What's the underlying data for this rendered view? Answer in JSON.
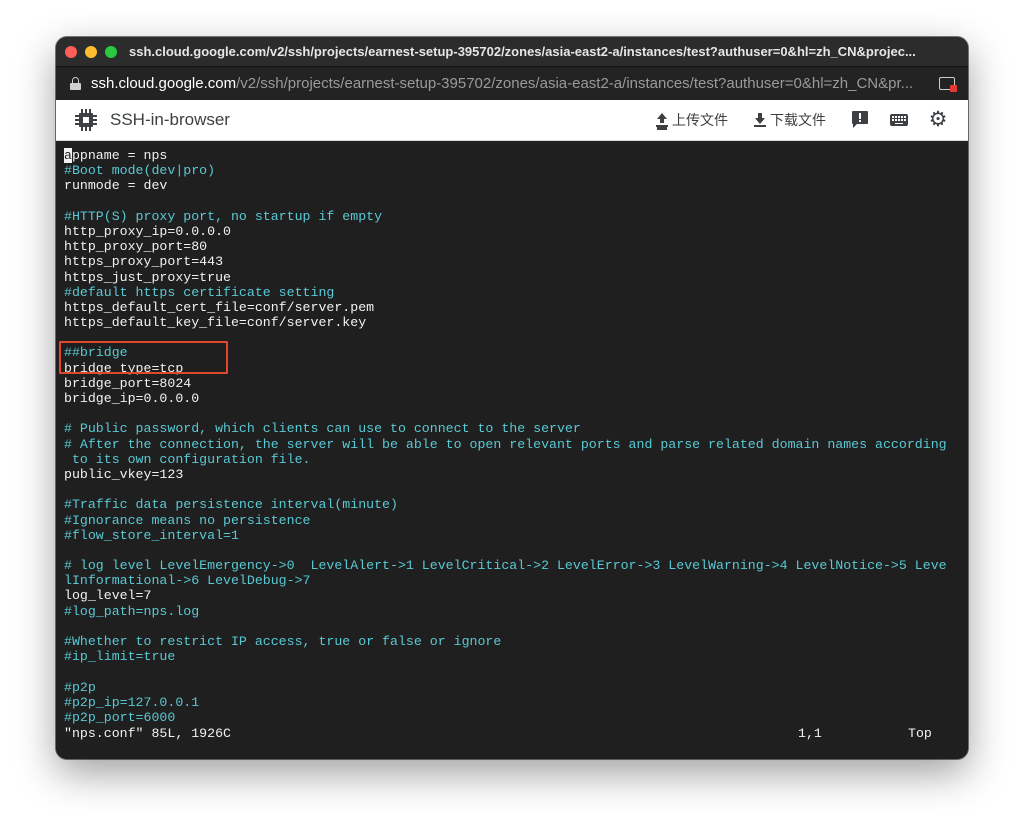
{
  "window": {
    "title": "ssh.cloud.google.com/v2/ssh/projects/earnest-setup-395702/zones/asia-east2-a/instances/test?authuser=0&hl=zh_CN&projec..."
  },
  "urlbar": {
    "host": "ssh.cloud.google.com",
    "path": "/v2/ssh/projects/earnest-setup-395702/zones/asia-east2-a/instances/test?authuser=0&hl=zh_CN&pr..."
  },
  "appbar": {
    "title": "SSH-in-browser",
    "upload_label": "上传文件",
    "download_label": "下载文件"
  },
  "terminal": {
    "cursor_char": "a",
    "first_line_rest": "ppname = nps",
    "lines": [
      {
        "text": "#Boot mode(dev|pro)",
        "comment": true
      },
      {
        "text": "runmode = dev",
        "comment": false
      },
      {
        "text": "",
        "comment": false
      },
      {
        "text": "#HTTP(S) proxy port, no startup if empty",
        "comment": true
      },
      {
        "text": "http_proxy_ip=0.0.0.0",
        "comment": false
      },
      {
        "text": "http_proxy_port=80",
        "comment": false
      },
      {
        "text": "https_proxy_port=443",
        "comment": false
      },
      {
        "text": "https_just_proxy=true",
        "comment": false
      },
      {
        "text": "#default https certificate setting",
        "comment": true
      },
      {
        "text": "https_default_cert_file=conf/server.pem",
        "comment": false
      },
      {
        "text": "https_default_key_file=conf/server.key",
        "comment": false
      },
      {
        "text": "",
        "comment": false
      },
      {
        "text": "##bridge",
        "comment": true
      },
      {
        "text": "bridge_type=tcp",
        "comment": false
      },
      {
        "text": "bridge_port=8024",
        "comment": false
      },
      {
        "text": "bridge_ip=0.0.0.0",
        "comment": false
      },
      {
        "text": "",
        "comment": false
      },
      {
        "text": "# Public password, which clients can use to connect to the server",
        "comment": true
      },
      {
        "text": "# After the connection, the server will be able to open relevant ports and parse related domain names according",
        "comment": true
      },
      {
        "text": " to its own configuration file.",
        "comment": true
      },
      {
        "text": "public_vkey=123",
        "comment": false
      },
      {
        "text": "",
        "comment": false
      },
      {
        "text": "#Traffic data persistence interval(minute)",
        "comment": true
      },
      {
        "text": "#Ignorance means no persistence",
        "comment": true
      },
      {
        "text": "#flow_store_interval=1",
        "comment": true
      },
      {
        "text": "",
        "comment": false
      },
      {
        "text": "# log level LevelEmergency->0  LevelAlert->1 LevelCritical->2 LevelError->3 LevelWarning->4 LevelNotice->5 Leve",
        "comment": true
      },
      {
        "text": "lInformational->6 LevelDebug->7",
        "comment": true
      },
      {
        "text": "log_level=7",
        "comment": false
      },
      {
        "text": "#log_path=nps.log",
        "comment": true
      },
      {
        "text": "",
        "comment": false
      },
      {
        "text": "#Whether to restrict IP access, true or false or ignore",
        "comment": true
      },
      {
        "text": "#ip_limit=true",
        "comment": true
      },
      {
        "text": "",
        "comment": false
      },
      {
        "text": "#p2p",
        "comment": true
      },
      {
        "text": "#p2p_ip=127.0.0.1",
        "comment": true
      },
      {
        "text": "#p2p_port=6000",
        "comment": true
      }
    ],
    "status_file": "\"nps.conf\" 85L, 1926C",
    "status_position": "1,1",
    "status_scroll": "Top"
  },
  "colors": {
    "terminal_bg": "#1f1f1f",
    "text": "#f2f2f2",
    "comment": "#59c9d4",
    "highlight_box": "#e0482a"
  }
}
